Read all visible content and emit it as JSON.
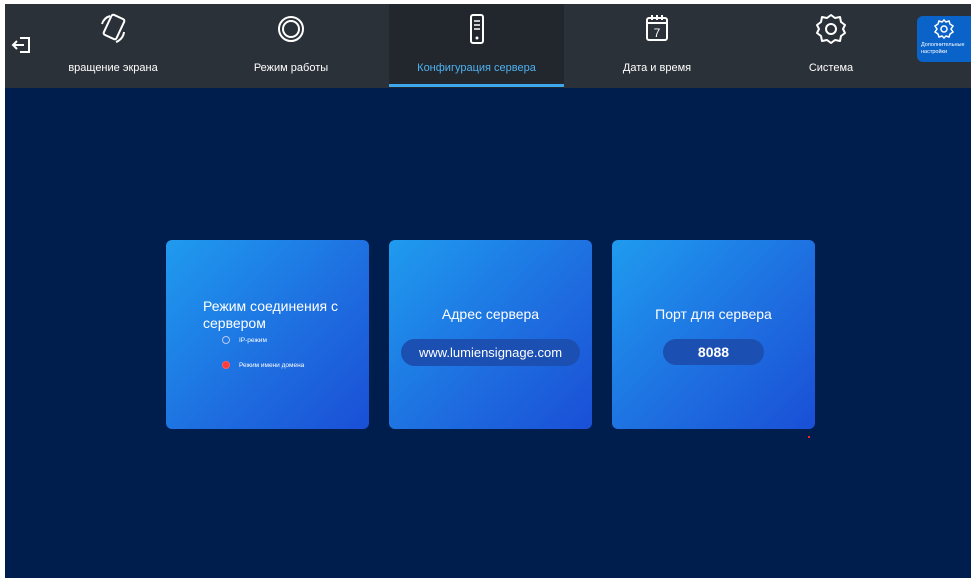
{
  "tabs": [
    {
      "label": "вращение экрана",
      "icon": "screen-rotation-icon"
    },
    {
      "label": "Режим работы",
      "icon": "work-mode-icon"
    },
    {
      "label": "Конфигурация сервера",
      "icon": "server-icon",
      "active": true
    },
    {
      "label": "Дата и время",
      "icon": "calendar-icon"
    },
    {
      "label": "Система",
      "icon": "system-gear-icon"
    }
  ],
  "calendar_day": "7",
  "advanced": {
    "label": "Дополнительные настройки",
    "icon": "advanced-settings-icon"
  },
  "cards": {
    "connection": {
      "title": "Режим соединения с сервером",
      "options": [
        {
          "label": "IP-режим",
          "selected": false
        },
        {
          "label": "Режим имени домена",
          "selected": true
        }
      ]
    },
    "address": {
      "title": "Адрес сервера",
      "value": "www.lumiensignage.com"
    },
    "port": {
      "title": "Порт для сервера",
      "value": "8088"
    }
  },
  "colors": {
    "background": "#001e4d",
    "topbar": "#2b3138",
    "accent": "#3ea6ea",
    "selected_radio": "#ff3b3b"
  }
}
